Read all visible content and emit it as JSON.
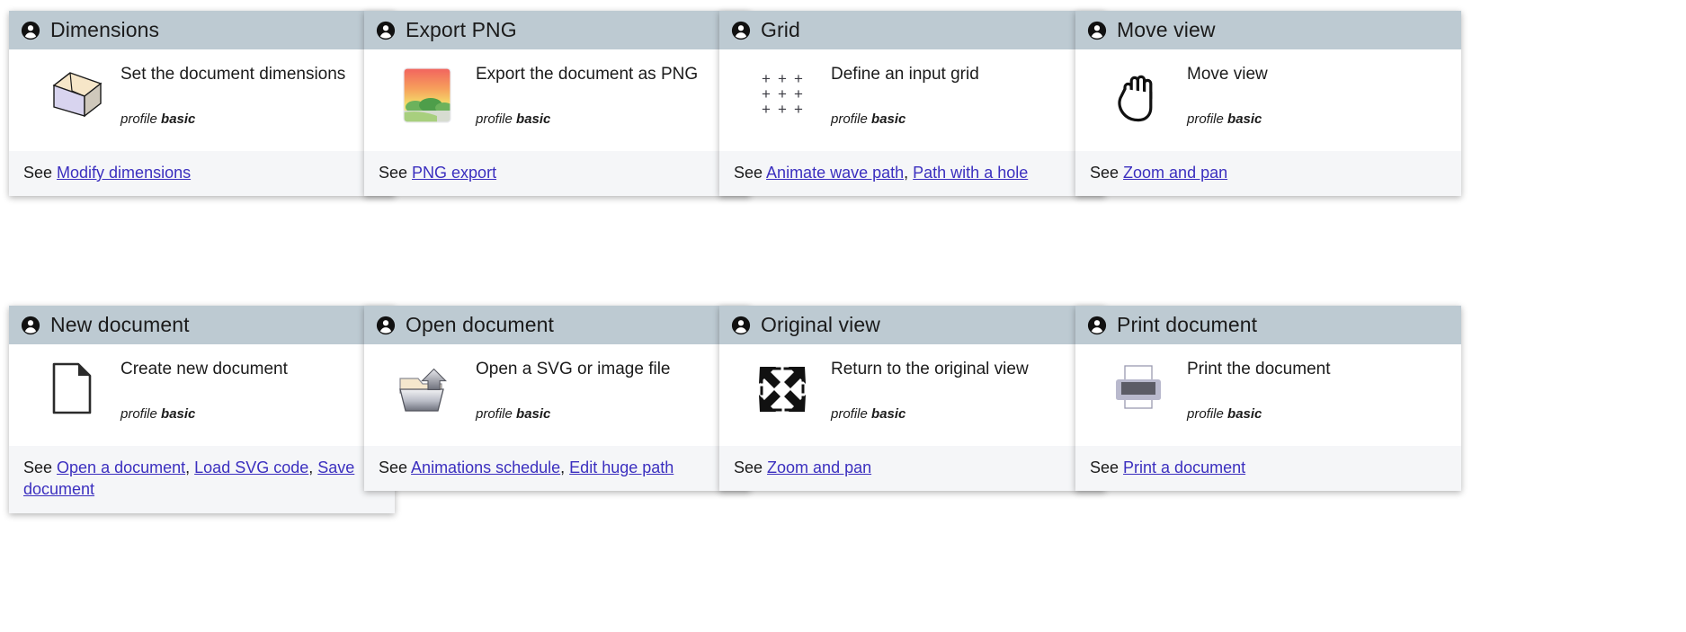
{
  "meta": {
    "see_label": "See",
    "profile_label": "profile",
    "profile_value": "basic",
    "header_bg": "#bdcad2",
    "footer_bg": "#f5f6f8",
    "link_color": "#3b2fbf",
    "text_color": "#1b1b1b"
  },
  "cards": [
    {
      "id": "dimensions",
      "title": "Dimensions",
      "header_icon": "person-icon",
      "icon": "box-3d-icon",
      "description": "Set the document dimensions",
      "profile": "basic",
      "links": [
        "Modify dimensions"
      ]
    },
    {
      "id": "export-png",
      "title": "Export PNG",
      "header_icon": "person-icon",
      "icon": "image-thumbnail-icon",
      "description": "Export the document as PNG",
      "profile": "basic",
      "links": [
        "PNG export"
      ]
    },
    {
      "id": "grid",
      "title": "Grid",
      "header_icon": "person-icon",
      "icon": "plus-grid-icon",
      "description": "Define an input grid",
      "profile": "basic",
      "links": [
        "Animate wave path",
        "Path with a hole"
      ]
    },
    {
      "id": "move-view",
      "title": "Move view",
      "header_icon": "person-icon",
      "icon": "open-hand-icon",
      "description": "Move view",
      "profile": "basic",
      "links": [
        "Zoom and pan"
      ]
    },
    {
      "id": "new-document",
      "title": "New document",
      "header_icon": "person-icon",
      "icon": "blank-page-icon",
      "description": "Create new document",
      "profile": "basic",
      "links": [
        "Open a document",
        "Load SVG code",
        "Save document"
      ]
    },
    {
      "id": "open-document",
      "title": "Open document",
      "header_icon": "person-icon",
      "icon": "open-folder-arrow-icon",
      "description": "Open a SVG or image file",
      "profile": "basic",
      "links": [
        "Animations schedule",
        "Edit huge path"
      ]
    },
    {
      "id": "original-view",
      "title": "Original view",
      "header_icon": "person-icon",
      "icon": "expand-arrows-icon",
      "description": "Return to the original view",
      "profile": "basic",
      "links": [
        "Zoom and pan"
      ]
    },
    {
      "id": "print-document",
      "title": "Print document",
      "header_icon": "person-icon",
      "icon": "printer-icon",
      "description": "Print the document",
      "profile": "basic",
      "links": [
        "Print a document"
      ]
    }
  ]
}
